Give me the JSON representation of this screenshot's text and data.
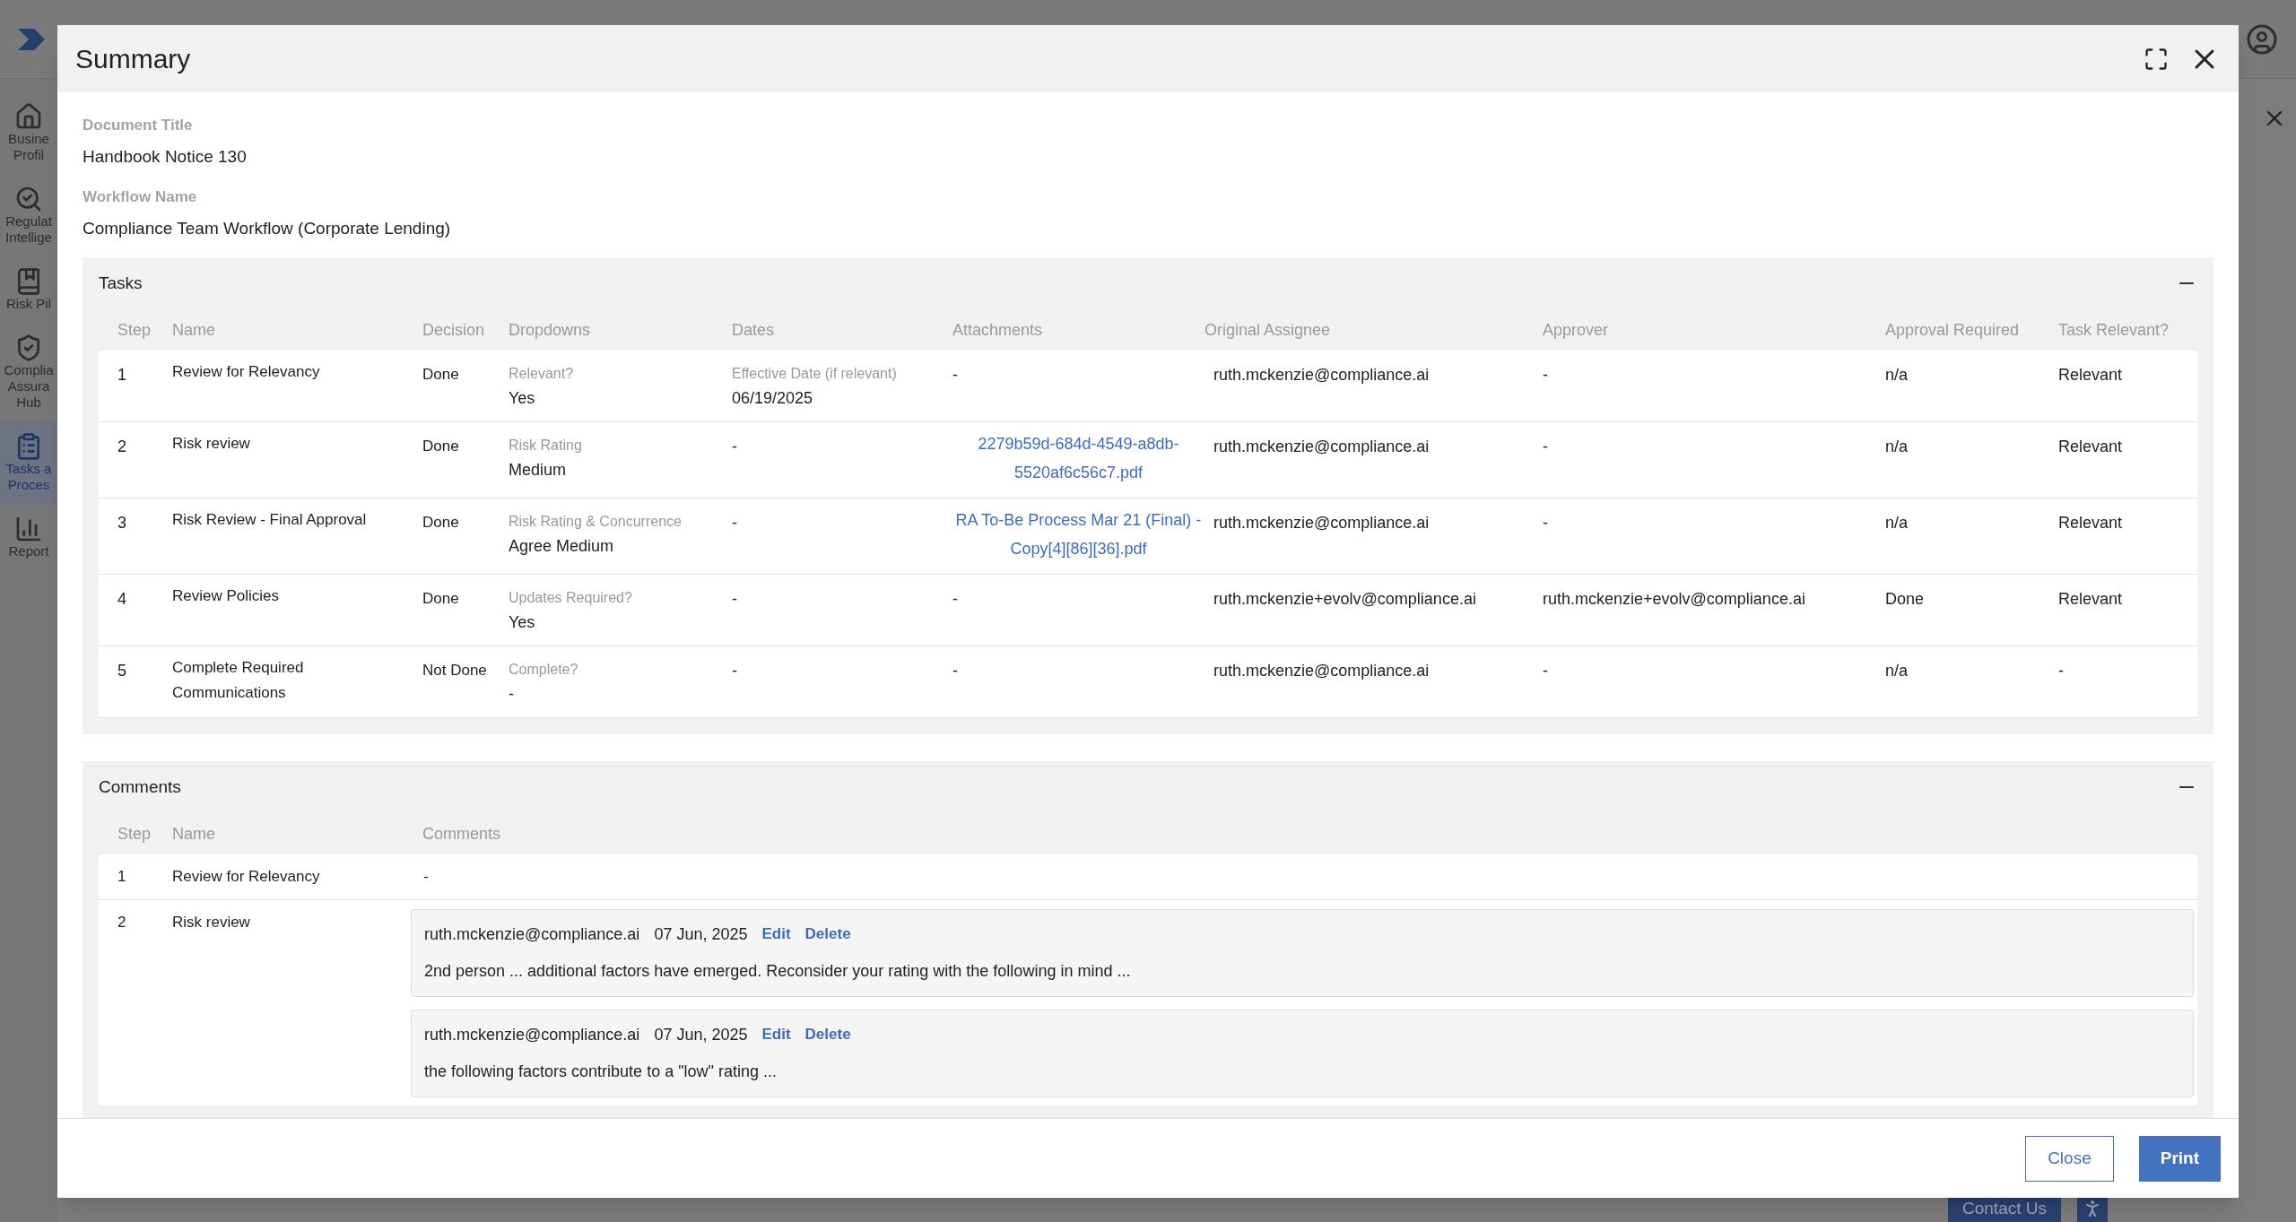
{
  "app": {
    "sidebar": [
      {
        "lines": [
          "Busine",
          "Profil"
        ],
        "selected": false
      },
      {
        "lines": [
          "Regulat",
          "Intellige"
        ],
        "selected": false
      },
      {
        "lines": [
          "Risk Pil"
        ],
        "selected": false
      },
      {
        "lines": [
          "Complia",
          "Assura",
          "Hub"
        ],
        "selected": false
      },
      {
        "lines": [
          "Tasks a",
          "Proces"
        ],
        "selected": true
      },
      {
        "lines": [
          "Report"
        ],
        "selected": false
      }
    ],
    "contact_button": "Contact Us"
  },
  "dialog": {
    "title": "Summary",
    "fields": [
      {
        "label": "Document Title",
        "value": "Handbook Notice 130"
      },
      {
        "label": "Workflow Name",
        "value": "Compliance Team Workflow (Corporate Lending)"
      }
    ],
    "tasks": {
      "title": "Tasks",
      "expanded": true,
      "columns": [
        "Step",
        "Name",
        "Decision",
        "Dropdowns",
        "Dates",
        "Attachments",
        "Original Assignee",
        "Approver",
        "Approval Required",
        "Task Relevant?"
      ],
      "rows": [
        {
          "step": "1",
          "name": "Review for Relevancy",
          "decision": "Done",
          "dropdown": {
            "label": "Relevant?",
            "value": "Yes"
          },
          "dates": {
            "label": "Effective Date (if relevant)",
            "value": "06/19/2025"
          },
          "attachment": {
            "kind": "text",
            "text": "-"
          },
          "assignee": "ruth.mckenzie@compliance.ai",
          "approver": "-",
          "approval_required": "n/a",
          "task_relevant": "Relevant"
        },
        {
          "step": "2",
          "name": "Risk review",
          "decision": "Done",
          "dropdown": {
            "label": "Risk Rating",
            "value": "Medium"
          },
          "dates": {
            "value": "-"
          },
          "attachment": {
            "kind": "link",
            "text": "2279b59d-684d-4549-a8db-5520af6c56c7.pdf"
          },
          "assignee": "ruth.mckenzie@compliance.ai",
          "approver": "-",
          "approval_required": "n/a",
          "task_relevant": "Relevant"
        },
        {
          "step": "3",
          "name": "Risk Review - Final Approval",
          "decision": "Done",
          "dropdown": {
            "label": "Risk Rating & Concurrence",
            "value": "Agree Medium"
          },
          "dates": {
            "value": "-"
          },
          "attachment": {
            "kind": "link",
            "text": "RA To-Be Process Mar 21 (Final) - Copy[4][86][36].pdf"
          },
          "assignee": "ruth.mckenzie@compliance.ai",
          "approver": "-",
          "approval_required": "n/a",
          "task_relevant": "Relevant"
        },
        {
          "step": "4",
          "name": "Review Policies",
          "decision": "Done",
          "dropdown": {
            "label": "Updates Required?",
            "value": "Yes"
          },
          "dates": {
            "value": "-"
          },
          "attachment": {
            "kind": "text",
            "text": "-"
          },
          "assignee": "ruth.mckenzie+evolv@compliance.ai",
          "approver": "ruth.mckenzie+evolv@compliance.ai",
          "approval_required": "Done",
          "task_relevant": "Relevant"
        },
        {
          "step": "5",
          "name": "Complete Required Communications",
          "decision": "Not Done",
          "dropdown": {
            "label": "Complete?",
            "value": "-"
          },
          "dates": {
            "value": "-"
          },
          "attachment": {
            "kind": "text",
            "text": "-"
          },
          "assignee": "ruth.mckenzie@compliance.ai",
          "approver": "-",
          "approval_required": "n/a",
          "task_relevant": "-"
        }
      ]
    },
    "comments": {
      "title": "Comments",
      "expanded": true,
      "columns": [
        "Step",
        "Name",
        "Comments"
      ],
      "rows": [
        {
          "step": "1",
          "name": "Review for Relevancy",
          "empty_text": "-"
        },
        {
          "step": "2",
          "name": "Risk review",
          "comments": [
            {
              "author": "ruth.mckenzie@compliance.ai",
              "date": "07 Jun, 2025",
              "actions": [
                "Edit",
                "Delete"
              ],
              "text": "2nd person ... additional factors have emerged. Reconsider your rating with the following in mind ..."
            },
            {
              "author": "ruth.mckenzie@compliance.ai",
              "date": "07 Jun, 2025",
              "actions": [
                "Edit",
                "Delete"
              ],
              "text": "the following factors contribute to a \"low\" rating ..."
            }
          ]
        }
      ]
    },
    "buttons": [
      {
        "label": "Close",
        "kind": "secondary"
      },
      {
        "label": "Print",
        "kind": "primary"
      }
    ]
  }
}
